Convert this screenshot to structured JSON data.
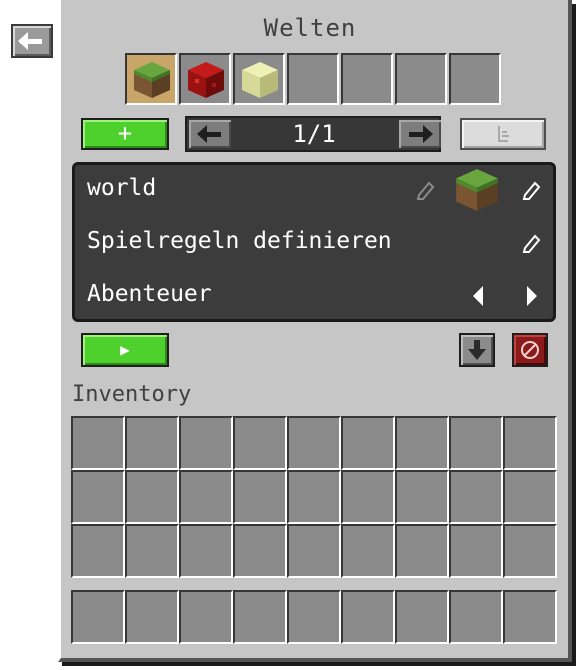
{
  "screen": {
    "title": "Welten"
  },
  "nav": {
    "back_icon": "arrow-left-icon"
  },
  "world_icons": [
    {
      "name": "grass-block",
      "color": "#5e9a3a"
    },
    {
      "name": "redstone-block",
      "color": "#a01010"
    },
    {
      "name": "end-stone-block",
      "color": "#dfe3a3"
    },
    {
      "name": "empty"
    },
    {
      "name": "empty"
    },
    {
      "name": "empty"
    },
    {
      "name": "empty"
    }
  ],
  "toolbar": {
    "add_label": "+",
    "page_text": "1/1",
    "prev_icon": "arrow-left-icon",
    "next_icon": "arrow-right-icon",
    "disabled_icon": "list-icon"
  },
  "world": {
    "name": "world",
    "gamerules_label": "Spielregeln definieren",
    "gamemode_label": "Abenteuer"
  },
  "actions": {
    "play_label": "▶",
    "download_icon": "download-icon",
    "delete_icon": "delete-icon"
  },
  "inventory": {
    "label": "Inventory",
    "rows": 3,
    "cols": 9,
    "hotbar_slots": 9
  },
  "colors": {
    "panel": "#c6c6c6",
    "slot": "#8b8b8b",
    "green_button": "#4fd12d",
    "settings_panel": "#3c3c3c",
    "delete_button": "#8b1a1a"
  }
}
